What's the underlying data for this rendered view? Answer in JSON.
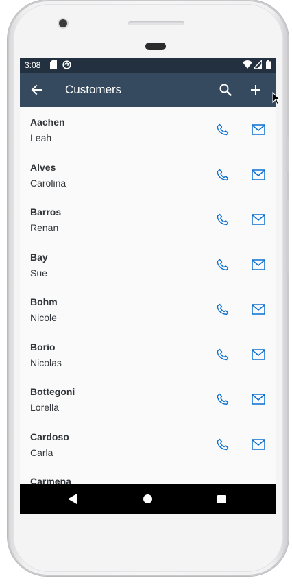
{
  "status_bar": {
    "time": "3:08"
  },
  "app_bar": {
    "title": "Customers",
    "icons": [
      "back-arrow-icon",
      "search-icon",
      "add-icon"
    ]
  },
  "customers": [
    {
      "last": "Aachen",
      "first": "Leah"
    },
    {
      "last": "Alves",
      "first": "Carolina"
    },
    {
      "last": "Barros",
      "first": "Renan"
    },
    {
      "last": "Bay",
      "first": "Sue"
    },
    {
      "last": "Bohm",
      "first": "Nicole"
    },
    {
      "last": "Borio",
      "first": "Nicolas"
    },
    {
      "last": "Bottegoni",
      "first": "Lorella"
    },
    {
      "last": "Cardoso",
      "first": "Carla"
    },
    {
      "last": "Carmena",
      "first": ""
    }
  ],
  "row_icons": [
    "phone-icon",
    "mail-icon"
  ],
  "colors": {
    "status_bar": "#22303f",
    "app_bar": "#354a5f",
    "accent": "#0a6ed1",
    "text": "#32363a",
    "list_bg": "#fafafa"
  }
}
